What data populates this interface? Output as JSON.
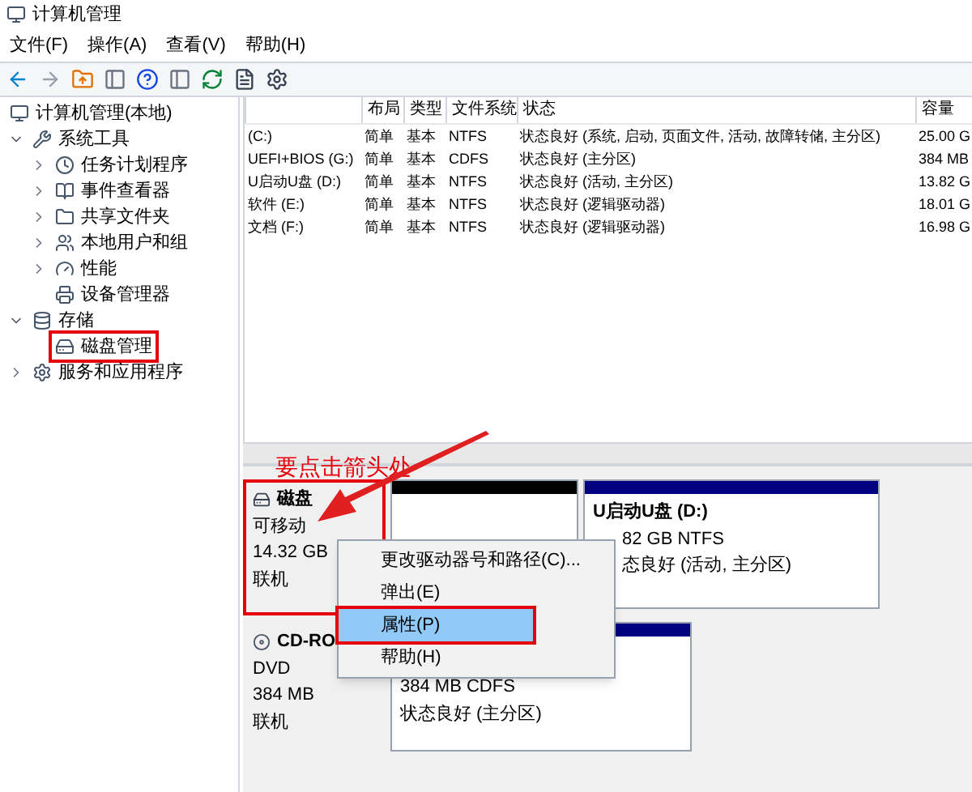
{
  "window": {
    "title": "计算机管理"
  },
  "menu": [
    "文件(F)",
    "操作(A)",
    "查看(V)",
    "帮助(H)"
  ],
  "tree": [
    {
      "label": "计算机管理(本地)",
      "children": [
        {
          "label": "系统工具",
          "expanded": true,
          "children": [
            {
              "label": "任务计划程序",
              "expanded": false
            },
            {
              "label": "事件查看器",
              "expanded": false
            },
            {
              "label": "共享文件夹",
              "expanded": false
            },
            {
              "label": "本地用户和组",
              "expanded": false
            },
            {
              "label": "性能",
              "expanded": false
            },
            {
              "label": "设备管理器"
            }
          ]
        },
        {
          "label": "存储",
          "expanded": true,
          "children": [
            {
              "label": "磁盘管理",
              "annotated": true
            }
          ]
        },
        {
          "label": "服务和应用程序",
          "expanded": false
        }
      ]
    }
  ],
  "table": {
    "columns": [
      "",
      "布局",
      "类型",
      "文件系统",
      "状态",
      "容量"
    ],
    "rows": [
      [
        "(C:)",
        "简单",
        "基本",
        "NTFS",
        "状态良好 (系统, 启动, 页面文件, 活动, 故障转储, 主分区)",
        "25.00 G"
      ],
      [
        "UEFI+BIOS (G:)",
        "简单",
        "基本",
        "CDFS",
        "状态良好 (主分区)",
        "384 MB"
      ],
      [
        "U启动U盘 (D:)",
        "简单",
        "基本",
        "NTFS",
        "状态良好 (活动, 主分区)",
        "13.82 G"
      ],
      [
        "软件 (E:)",
        "简单",
        "基本",
        "NTFS",
        "状态良好 (逻辑驱动器)",
        "18.01 G"
      ],
      [
        "文档 (F:)",
        "简单",
        "基本",
        "NTFS",
        "状态良好 (逻辑驱动器)",
        "16.98 G"
      ]
    ]
  },
  "annotation": {
    "text": "要点击箭头处"
  },
  "disks": [
    {
      "kind": "removable",
      "name": "磁盘",
      "lines": [
        "可移动",
        "14.32 GB",
        "联机"
      ],
      "annotated": true,
      "partitions": [
        {
          "kind": "unallocated"
        },
        {
          "kind": "primary",
          "label": "U启动U盘  (D:)",
          "lines": [
            "82 GB NTFS",
            "态良好 (活动, 主分区)"
          ]
        }
      ]
    },
    {
      "kind": "cdrom",
      "name": "CD-RO",
      "lines": [
        "DVD",
        "384 MB",
        "联机"
      ],
      "annotated": false,
      "partitions": [
        {
          "kind": "primary",
          "lines": [
            "384 MB CDFS",
            "状态良好 (主分区)"
          ]
        }
      ]
    }
  ],
  "context_menu": [
    {
      "label": "更改驱动器号和路径(C)...",
      "selected": false
    },
    {
      "label": "弹出(E)",
      "selected": false
    },
    {
      "label": "属性(P)",
      "selected": true
    },
    {
      "label": "帮助(H)",
      "selected": false
    }
  ]
}
